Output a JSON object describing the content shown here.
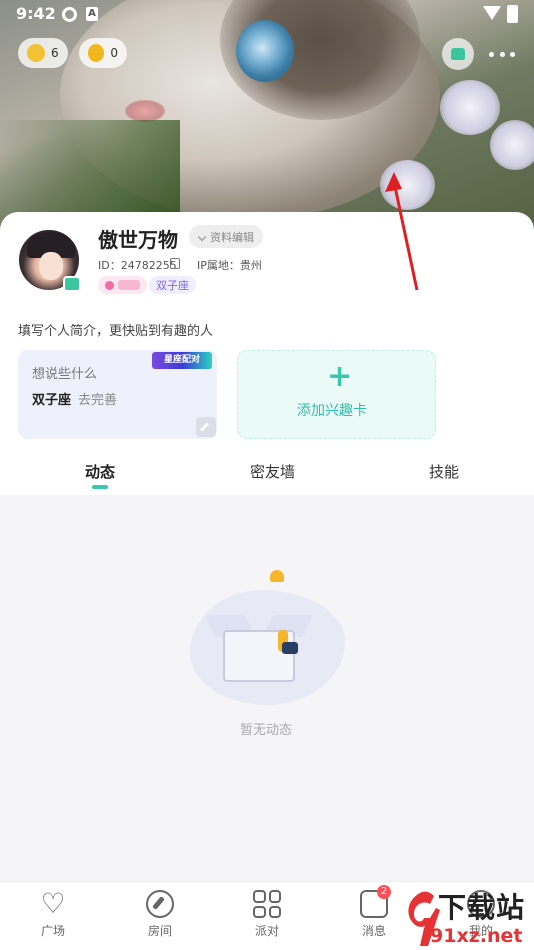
{
  "status_bar": {
    "time": "9:42"
  },
  "cover_chips": {
    "like_count": "6",
    "coin_count": "0"
  },
  "profile": {
    "nickname": "傲世万物",
    "edit_label": "资料编辑",
    "id_text": "ID：24782255",
    "ip_text": "IP属地：贵州",
    "gender_tag": "",
    "zodiac_tag": "双子座",
    "intro_placeholder": "填写个人简介，更快贴到有趣的人"
  },
  "note_card": {
    "badge": "星座配对",
    "prompt": "想说些什么",
    "zodiac": "双子座",
    "todo": "去完善"
  },
  "interest_card": {
    "plus": "+",
    "label": "添加兴趣卡"
  },
  "tabs": [
    "动态",
    "密友墙",
    "技能"
  ],
  "empty_state": {
    "text": "暂无动态"
  },
  "bottom_nav": {
    "items": [
      {
        "label": "广场",
        "icon": "heart-icon"
      },
      {
        "label": "房间",
        "icon": "compass-icon"
      },
      {
        "label": "派对",
        "icon": "grid-icon"
      },
      {
        "label": "消息",
        "icon": "message-icon"
      },
      {
        "label": "我的",
        "icon": "profile-icon"
      }
    ],
    "message_badge": "2"
  },
  "watermark": {
    "brand": "下载站",
    "url": "91xz.net"
  },
  "colors": {
    "accent": "#3ac7b0",
    "badge_red": "#ff4d57",
    "arrow_red": "#e02020"
  }
}
